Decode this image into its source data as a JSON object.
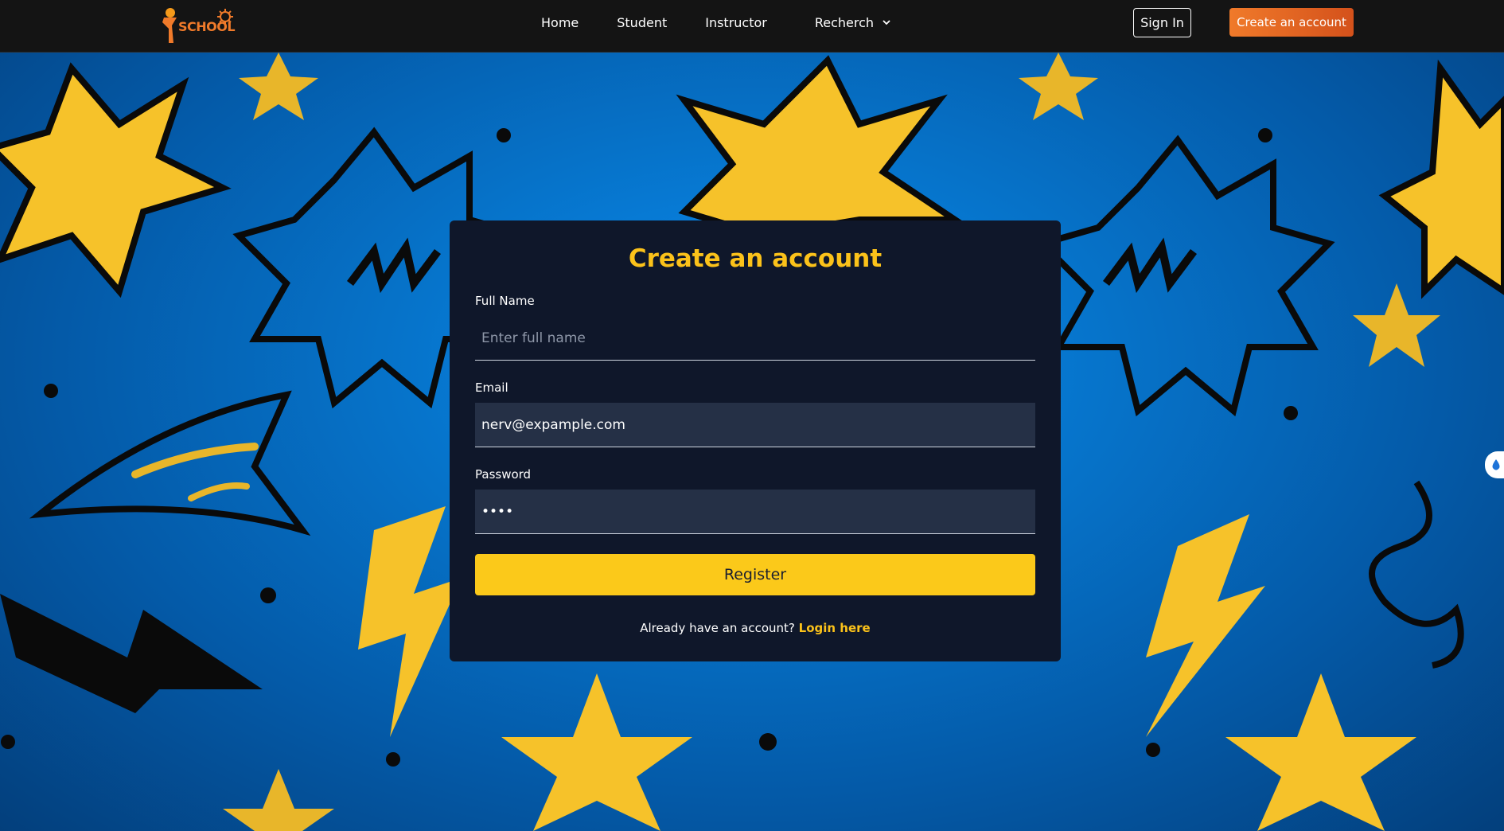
{
  "header": {
    "logo_text": "SCHOOL",
    "nav": [
      "Home",
      "Student",
      "Instructor",
      "Recherch"
    ],
    "sign_in_label": "Sign In",
    "create_account_label": "Create an account"
  },
  "form": {
    "title": "Create an account",
    "full_name_label": "Full Name",
    "full_name_placeholder": "Enter full name",
    "email_label": "Email",
    "email_value": "nerv@expample.com",
    "password_label": "Password",
    "password_value": "••••",
    "register_label": "Register",
    "already_text": "Already have an account?",
    "login_link_label": "Login here"
  },
  "colors": {
    "accent_yellow": "#fbc21a",
    "brand_orange": "#f07a2a",
    "card_bg": "#0f172a",
    "background_blue": "#0672c8"
  }
}
